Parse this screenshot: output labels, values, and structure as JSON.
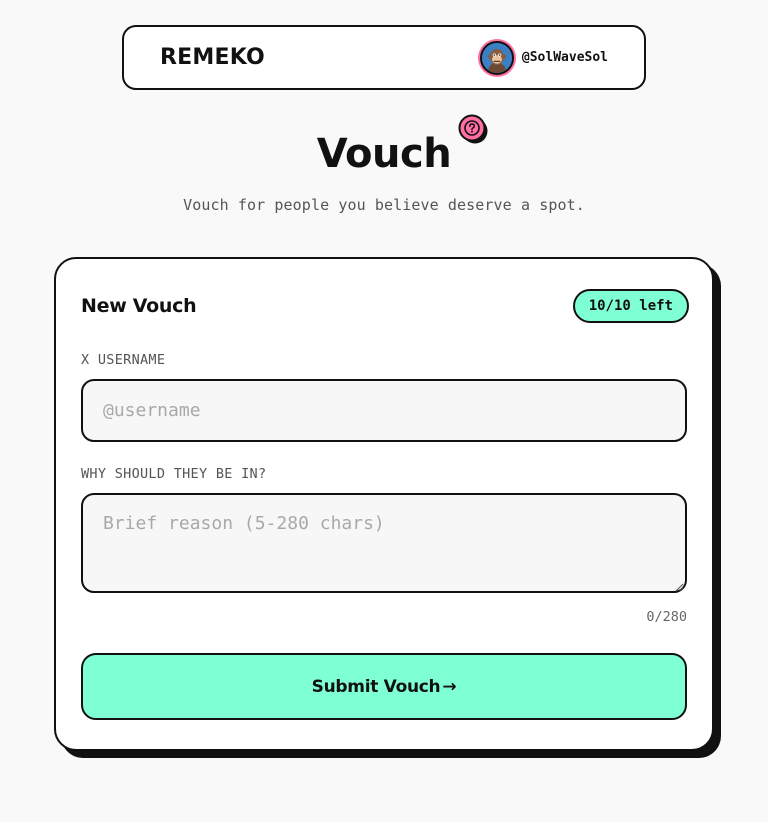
{
  "header": {
    "brand": "REMEKO",
    "user_handle": "@SolWaveSol",
    "avatar_icon": "ape-avatar-icon"
  },
  "page": {
    "title": "Vouch",
    "help_icon": "question-circle-icon",
    "subtitle": "Vouch for people you believe deserve a spot."
  },
  "card": {
    "title": "New Vouch",
    "remaining_badge": "10/10 left",
    "username_label": "X USERNAME",
    "username_value": "",
    "username_placeholder": "@username",
    "reason_label": "WHY SHOULD THEY BE IN?",
    "reason_value": "",
    "reason_placeholder": "Brief reason (5-280 chars)",
    "char_counter": "0/280",
    "submit_label": "Submit Vouch",
    "submit_arrow": "→"
  },
  "colors": {
    "background": "#f9f9f9",
    "accent_mint": "#7fffd4",
    "accent_pink": "#ff6fa3",
    "ink": "#111111"
  }
}
